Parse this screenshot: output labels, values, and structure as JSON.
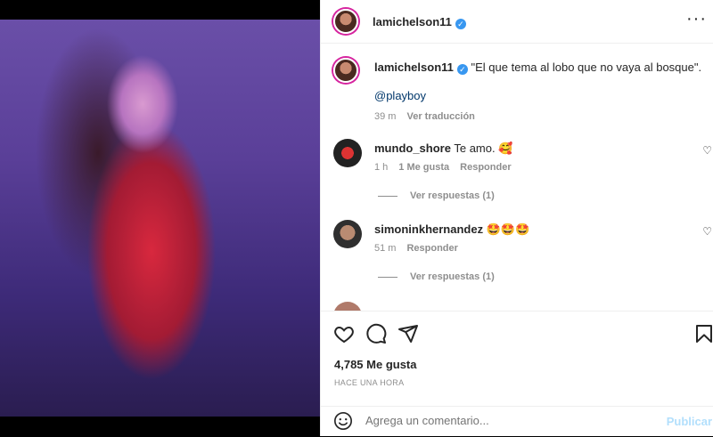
{
  "post": {
    "author": "lamichelson11",
    "caption": "\"El que tema al lobo que no vaya al bosque\".",
    "mention": "@playboy",
    "caption_time": "39 m",
    "translate": "Ver traducción"
  },
  "comments": [
    {
      "user": "mundo_shore",
      "text": "Te amo.",
      "emoji": "🥰",
      "time": "1 h",
      "likes": "1 Me gusta",
      "reply": "Responder",
      "view_replies": "Ver respuestas (1)"
    },
    {
      "user": "simoninkhernandez",
      "text": "",
      "emoji": "🤩🤩🤩",
      "time": "51 m",
      "reply": "Responder",
      "view_replies": "Ver respuestas (1)"
    }
  ],
  "likes_count": "4,785 Me gusta",
  "posted_ago": "HACE UNA HORA",
  "compose": {
    "placeholder": "Agrega un comentario...",
    "publish": "Publicar"
  },
  "icons": {
    "more": "more-options-icon",
    "like": "heart-icon",
    "comment": "comment-icon",
    "share": "share-icon",
    "save": "bookmark-icon",
    "emoji": "emoji-icon"
  },
  "colors": {
    "link": "#00376b",
    "verified": "#3897f0",
    "publish_disabled": "#b2dffc",
    "meta": "#8e8e8e"
  }
}
